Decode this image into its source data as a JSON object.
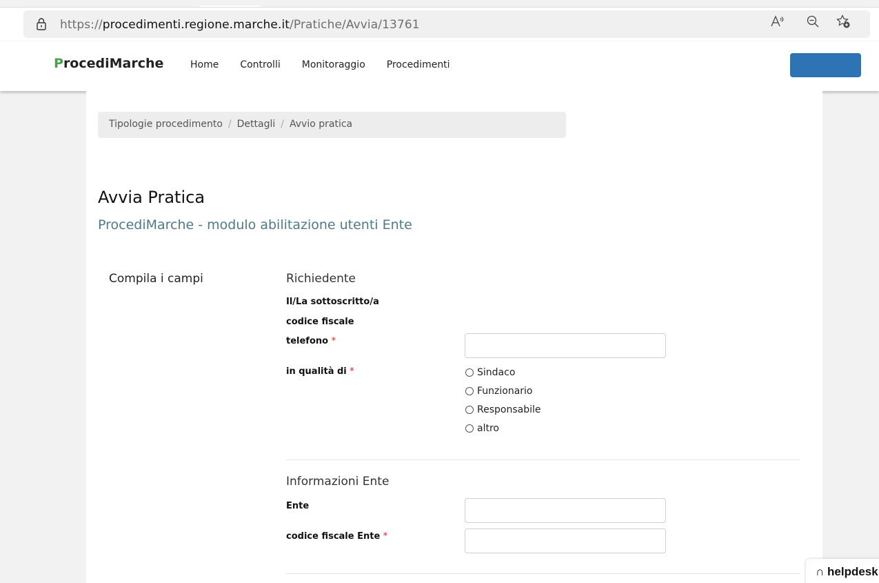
{
  "browser": {
    "url_prefix": "https://",
    "url_host": "procedimenti.regione.marche.it",
    "url_path": "/Pratiche/Avvia/13761"
  },
  "header": {
    "brand_p": "P",
    "brand_rest": "rocediMarche",
    "nav": [
      "Home",
      "Controlli",
      "Monitoraggio",
      "Procedimenti"
    ],
    "accent_color": "#2e74b5"
  },
  "breadcrumb": [
    "Tipologie procedimento",
    "Dettagli",
    "Avvio pratica"
  ],
  "page": {
    "title": "Avvia Pratica",
    "subtitle": "ProcediMarche - modulo abilitazione utenti Ente",
    "side_label": "Compila i campi"
  },
  "richiedente": {
    "section_title": "Richiedente",
    "sottoscritto_label": "Il/La sottoscritto/a",
    "cf_label": "codice fiscale",
    "telefono_label": "telefono",
    "telefono_value": "",
    "qualita_label": "in qualità di",
    "qualita_options": [
      "Sindaco",
      "Funzionario",
      "Responsabile",
      "altro"
    ],
    "required_mark": "*"
  },
  "ente": {
    "section_title": "Informazioni Ente",
    "ente_label": "Ente",
    "ente_value": "",
    "cf_ente_label": "codice fiscale Ente",
    "cf_ente_value": "",
    "required_mark": "*"
  },
  "helpdesk": {
    "label": "helpdesk"
  }
}
